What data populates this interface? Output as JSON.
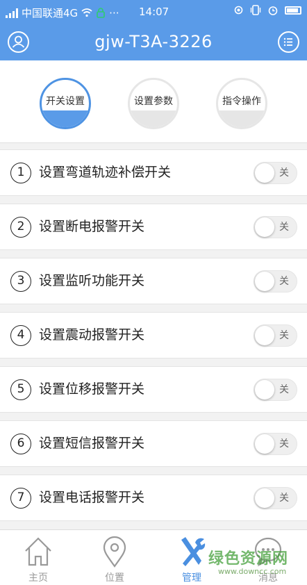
{
  "status_bar": {
    "carrier": "中国联通4G",
    "time": "14:07",
    "dots": "···"
  },
  "header": {
    "title": "gjw-T3A-3226"
  },
  "tabs": [
    {
      "label": "开关设置",
      "active": true
    },
    {
      "label": "设置参数",
      "active": false
    },
    {
      "label": "指令操作",
      "active": false
    }
  ],
  "settings": [
    {
      "num": "1",
      "label": "设置弯道轨迹补偿开关",
      "state": "关"
    },
    {
      "num": "2",
      "label": "设置断电报警开关",
      "state": "关"
    },
    {
      "num": "3",
      "label": "设置监听功能开关",
      "state": "关"
    },
    {
      "num": "4",
      "label": "设置震动报警开关",
      "state": "关"
    },
    {
      "num": "5",
      "label": "设置位移报警开关",
      "state": "关"
    },
    {
      "num": "6",
      "label": "设置短信报警开关",
      "state": "关"
    },
    {
      "num": "7",
      "label": "设置电话报警开关",
      "state": "关"
    }
  ],
  "nav": [
    {
      "label": "主页",
      "icon": "home-icon"
    },
    {
      "label": "位置",
      "icon": "location-pin-icon"
    },
    {
      "label": "管理",
      "icon": "tools-icon",
      "active": true
    },
    {
      "label": "消息",
      "icon": "chat-bubble-icon"
    }
  ],
  "watermark": {
    "text": "绿色资源网",
    "url": "www.downcc.com"
  },
  "colors": {
    "primary": "#5a9be8",
    "active_nav": "#4a8fe0"
  }
}
